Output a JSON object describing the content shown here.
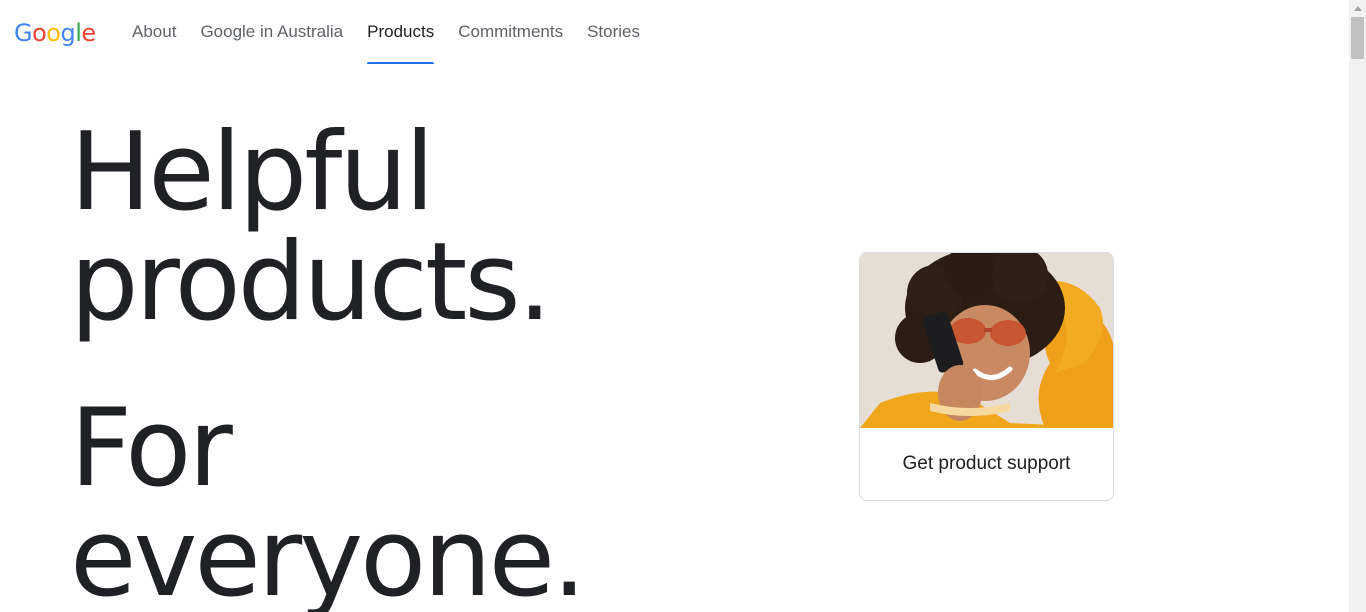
{
  "header": {
    "logo_letters": [
      {
        "char": "G",
        "color": "#4285F4"
      },
      {
        "char": "o",
        "color": "#EA4335"
      },
      {
        "char": "o",
        "color": "#FBBC05"
      },
      {
        "char": "g",
        "color": "#4285F4"
      },
      {
        "char": "l",
        "color": "#34A853"
      },
      {
        "char": "e",
        "color": "#EA4335"
      }
    ],
    "nav": [
      {
        "label": "About",
        "active": false
      },
      {
        "label": "Google in Australia",
        "active": false
      },
      {
        "label": "Products",
        "active": true
      },
      {
        "label": "Commitments",
        "active": false
      },
      {
        "label": "Stories",
        "active": false
      }
    ]
  },
  "hero": {
    "line1": "Helpful",
    "line2": "products.",
    "line3": "For",
    "line4": "everyone."
  },
  "support_card": {
    "label": "Get product support",
    "image_icon": "person-with-phone-photo"
  },
  "colors": {
    "accent": "#1a73e8",
    "text_primary": "#202124",
    "text_secondary": "#5f6368"
  }
}
